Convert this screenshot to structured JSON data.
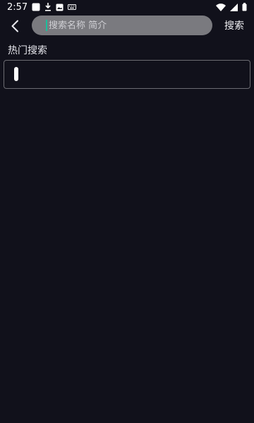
{
  "status_bar": {
    "time": "2:57",
    "icons_left": [
      "app-square-icon",
      "download-icon",
      "image-icon",
      "keyboard-icon"
    ],
    "icons_right": [
      "wifi-icon",
      "signal-icon",
      "battery-icon"
    ]
  },
  "header": {
    "back_icon": "chevron-left-icon",
    "search_placeholder": "搜索名称 简介",
    "search_value": "",
    "search_button_label": "搜索"
  },
  "hot_search": {
    "title": "热门搜索",
    "items": []
  },
  "colors": {
    "background": "#11111b",
    "search_pill": "#7a7a7f",
    "caret": "#1bbf9c",
    "border": "#6c6c72"
  }
}
